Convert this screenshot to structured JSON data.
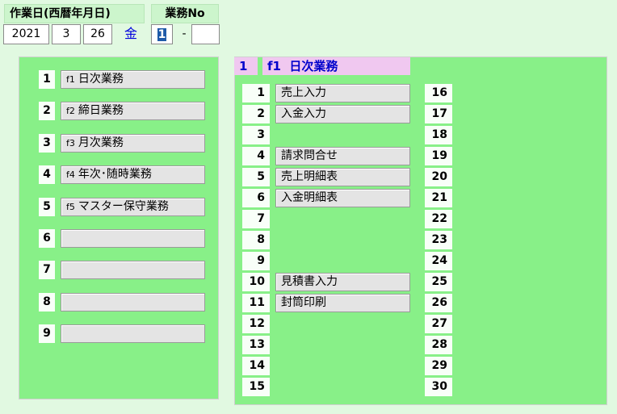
{
  "header": {
    "date_label": "作業日(西暦年月日)",
    "no_label": "業務No",
    "year": "2021",
    "month": "3",
    "day": "26",
    "weekday": "金",
    "no_value": "1",
    "separator": "-",
    "no_sub": ""
  },
  "left_menu": [
    {
      "num": "1",
      "fkey": "f1",
      "label": "日次業務"
    },
    {
      "num": "2",
      "fkey": "f2",
      "label": "締日業務"
    },
    {
      "num": "3",
      "fkey": "f3",
      "label": "月次業務"
    },
    {
      "num": "4",
      "fkey": "f4",
      "label": "年次･随時業務"
    },
    {
      "num": "5",
      "fkey": "f5",
      "label": "マスター保守業務"
    },
    {
      "num": "6",
      "fkey": "",
      "label": ""
    },
    {
      "num": "7",
      "fkey": "",
      "label": ""
    },
    {
      "num": "8",
      "fkey": "",
      "label": ""
    },
    {
      "num": "9",
      "fkey": "",
      "label": ""
    }
  ],
  "right_panel": {
    "title_num": "1",
    "title_fkey": "f1",
    "title_label": "日次業務",
    "items_left": [
      {
        "num": "1",
        "label": "売上入力"
      },
      {
        "num": "2",
        "label": "入金入力"
      },
      {
        "num": "3",
        "label": ""
      },
      {
        "num": "4",
        "label": "請求問合せ"
      },
      {
        "num": "5",
        "label": "売上明細表"
      },
      {
        "num": "6",
        "label": "入金明細表"
      },
      {
        "num": "7",
        "label": ""
      },
      {
        "num": "8",
        "label": ""
      },
      {
        "num": "9",
        "label": ""
      },
      {
        "num": "10",
        "label": "見積書入力"
      },
      {
        "num": "11",
        "label": "封筒印刷"
      },
      {
        "num": "12",
        "label": ""
      },
      {
        "num": "13",
        "label": ""
      },
      {
        "num": "14",
        "label": ""
      },
      {
        "num": "15",
        "label": ""
      }
    ],
    "items_right": [
      "16",
      "17",
      "18",
      "19",
      "20",
      "21",
      "22",
      "23",
      "24",
      "25",
      "26",
      "27",
      "28",
      "29",
      "30"
    ]
  }
}
